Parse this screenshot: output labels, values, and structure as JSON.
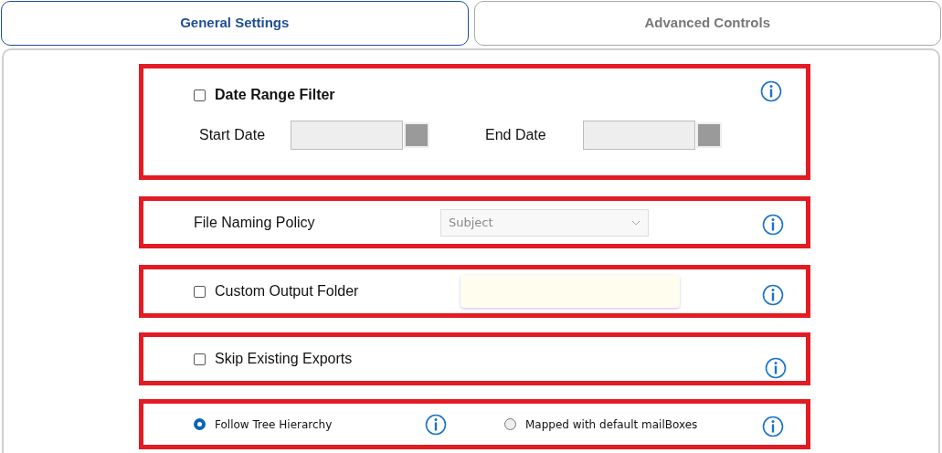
{
  "tabs": [
    {
      "label": "General Settings",
      "selected": true
    },
    {
      "label": "Advanced Controls",
      "selected": false
    }
  ],
  "date_filter": {
    "label": "Date Range Filter",
    "checked": false,
    "start_label": "Start Date",
    "end_label": "End Date"
  },
  "file_naming": {
    "label": "File Naming Policy",
    "value": "Subject"
  },
  "custom_output": {
    "label": "Custom Output Folder",
    "checked": false
  },
  "skip_existing": {
    "label": "Skip Existing Exports",
    "checked": false
  },
  "hierarchy_options": [
    {
      "label": "Follow Tree Hierarchy",
      "selected": true
    },
    {
      "label": "Mapped with default mailBoxes",
      "selected": false
    }
  ]
}
